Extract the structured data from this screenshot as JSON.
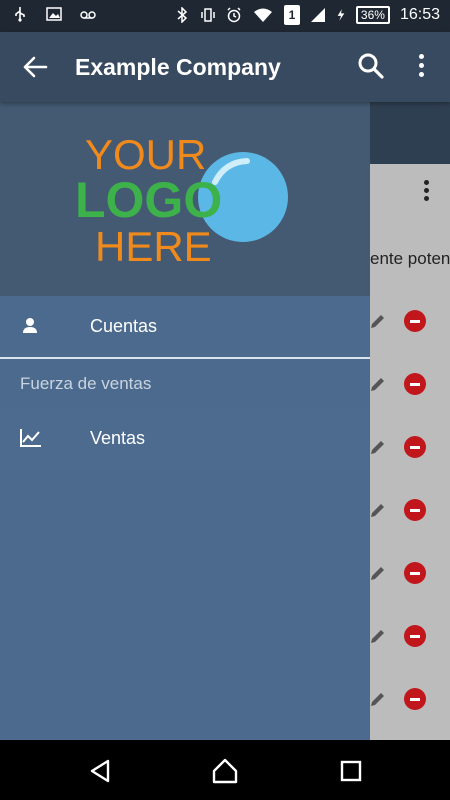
{
  "status_bar": {
    "battery": "36%",
    "time": "16:53",
    "sim_slot": "1"
  },
  "app_bar": {
    "title": "Example Company"
  },
  "drawer": {
    "logo": {
      "line1": "YOUR",
      "line2": "LOGO",
      "line3": "HERE"
    },
    "items": [
      {
        "label": "Cuentas",
        "icon": "user-icon"
      },
      {
        "label": "Ventas",
        "icon": "chart-icon"
      }
    ],
    "section_header": "Fuerza de ventas"
  },
  "background": {
    "partial_text": "ente poten"
  },
  "colors": {
    "app_bar": "#384a5f",
    "drawer": "#4c6a8d",
    "drawer_header": "#435a72",
    "status_bar": "#1f2732",
    "accent_red": "#c0161c",
    "logo_orange": "#f08a1c",
    "logo_green": "#3db24a",
    "logo_blue": "#5bb8e6"
  }
}
